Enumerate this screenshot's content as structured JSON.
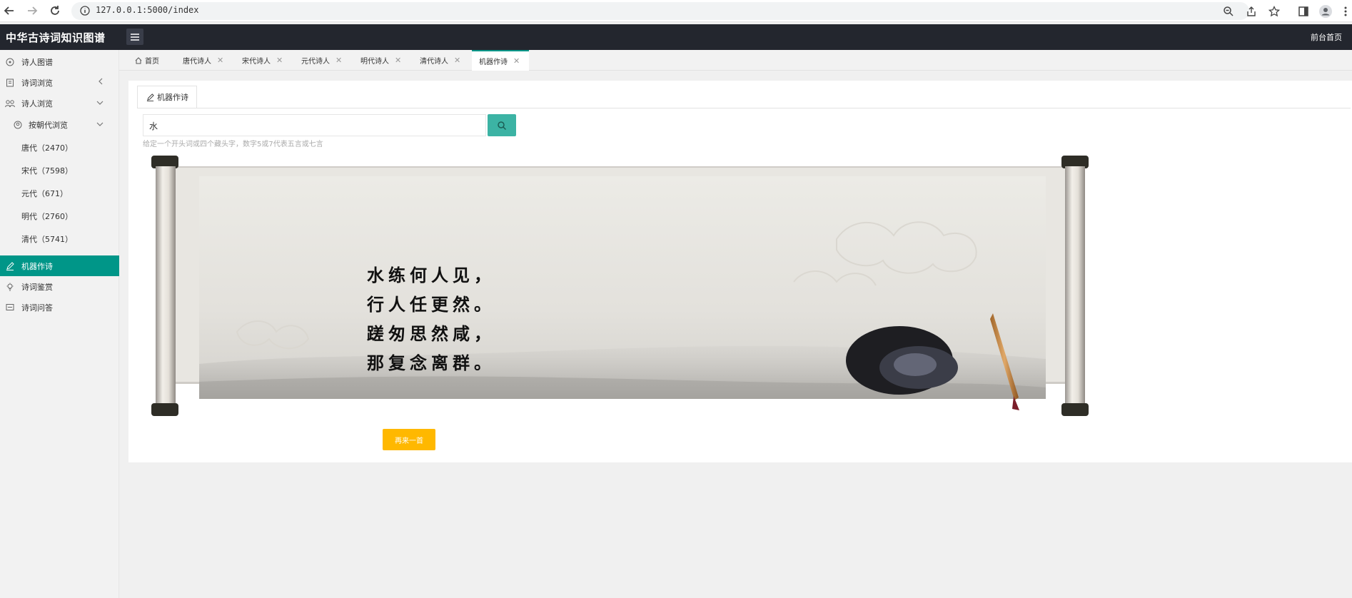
{
  "browser": {
    "url": "127.0.0.1:5000/index"
  },
  "header": {
    "brand": "中华古诗词知识图谱",
    "front_link": "前台首页"
  },
  "sidebar": {
    "poet_graph": "诗人图谱",
    "poem_browse": "诗词浏览",
    "poet_browse": "诗人浏览",
    "by_dynasty": "按朝代浏览",
    "dynasties": [
      "唐代（2470）",
      "宋代（7598）",
      "元代（671）",
      "明代（2760）",
      "清代（5741）"
    ],
    "machine_poem": "机器作诗",
    "appreciation": "诗词鉴赏",
    "qa": "诗词问答"
  },
  "tabs": {
    "home": "首页",
    "tang": "唐代诗人",
    "song": "宋代诗人",
    "yuan": "元代诗人",
    "ming": "明代诗人",
    "qing": "清代诗人",
    "machine": "机器作诗"
  },
  "content": {
    "inner_tab": "机器作诗",
    "search_value": "水",
    "hint": "给定一个开头词或四个藏头字，数字5或7代表五言或七言",
    "poem_lines": [
      "水练何人见，",
      "行人任更然。",
      "蹉匆思然咸，",
      "那复念离群。"
    ],
    "again_button": "再来一首"
  }
}
